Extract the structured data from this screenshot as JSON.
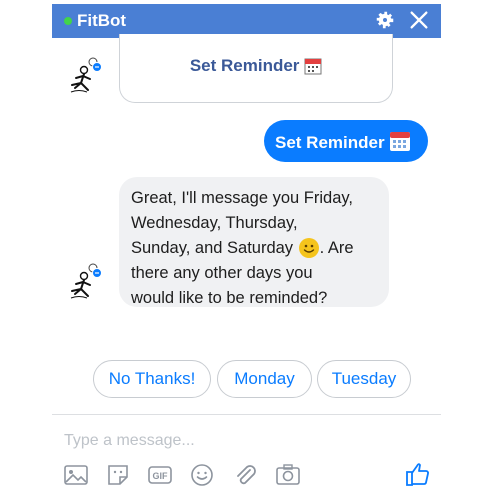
{
  "header": {
    "title": "FitBot",
    "status_color": "#42d44a",
    "background": "#4a7fd4"
  },
  "messages": {
    "card_button_label": "Set Reminder",
    "card_button_icon": "calendar-icon",
    "outgoing_text": "Set Reminder",
    "outgoing_icon": "calendar-icon",
    "incoming_line1": "Great, I'll message you Friday,",
    "incoming_line2": "Wednesday, Thursday,",
    "incoming_line3a": "Sunday, and Saturday",
    "incoming_line3b": ". Are",
    "incoming_line4": "there any other days you",
    "incoming_line5": "would like to be reminded?",
    "incoming_emoji": "smiley-emoji"
  },
  "quick_replies": [
    "No Thanks!",
    "Monday",
    "Tuesday"
  ],
  "composer": {
    "placeholder": "Type a message...",
    "tools": [
      "image-icon",
      "sticker-icon",
      "gif-icon",
      "emoji-icon",
      "paperclip-icon",
      "camera-icon",
      "thumbs-up-icon"
    ],
    "gif_label": "GIF"
  },
  "colors": {
    "accent": "#0a7cff",
    "card_text": "#3b5998",
    "bubble_gray": "#f0f1f3"
  }
}
